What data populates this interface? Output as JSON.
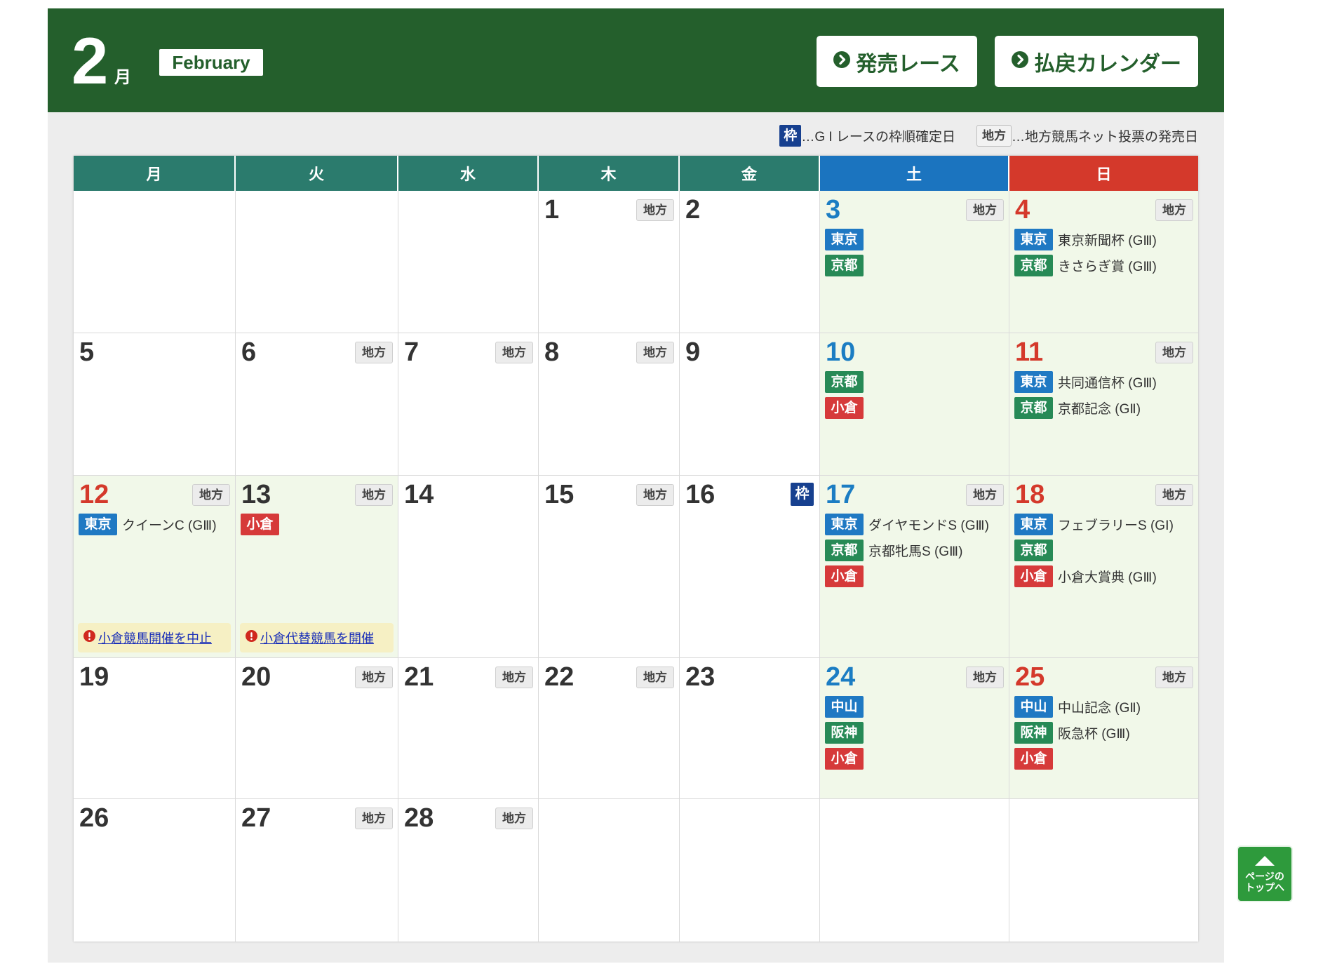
{
  "header": {
    "month_number": "2",
    "month_kanji": "月",
    "month_english": "February",
    "buttons": [
      {
        "label": "発売レース",
        "icon": "circle-chevron-right-icon"
      },
      {
        "label": "払戻カレンダー",
        "icon": "circle-chevron-right-icon"
      }
    ]
  },
  "labels": {
    "waku": "枠",
    "chiho": "地方"
  },
  "legend": [
    {
      "badge": "waku",
      "text": "…G I レースの枠順確定日"
    },
    {
      "badge": "chiho",
      "text": "…地方競馬ネット投票の発売日"
    }
  ],
  "weekdays": [
    {
      "label": "月",
      "tone": "weekday"
    },
    {
      "label": "火",
      "tone": "weekday"
    },
    {
      "label": "水",
      "tone": "weekday"
    },
    {
      "label": "木",
      "tone": "weekday"
    },
    {
      "label": "金",
      "tone": "weekday"
    },
    {
      "label": "土",
      "tone": "sat"
    },
    {
      "label": "日",
      "tone": "sun"
    }
  ],
  "colors": {
    "header_green": "#245f2c",
    "header_tones": {
      "weekday": "#2b7b6d",
      "sat": "#1b74bf",
      "sun": "#d4392b"
    },
    "day_tones": {
      "dark": "#333333",
      "blue": "#1b7dc3",
      "red": "#d4392b"
    },
    "shaded_cell": "#f1f8e9",
    "venues": {
      "東京": "#1f79c3",
      "京都": "#278a56",
      "小倉": "#d63a3a",
      "中山": "#1f79c3",
      "阪神": "#278a56"
    },
    "alert": "#d0281d",
    "page_top": "#2e9a3c"
  },
  "weeks": [
    [
      null,
      null,
      null,
      {
        "day": "1",
        "tone": "dark",
        "chiho": true
      },
      {
        "day": "2",
        "tone": "dark"
      },
      {
        "day": "3",
        "tone": "blue",
        "shaded": true,
        "chiho": true,
        "races": [
          {
            "venue": "東京"
          },
          {
            "venue": "京都"
          }
        ]
      },
      {
        "day": "4",
        "tone": "red",
        "shaded": true,
        "chiho": true,
        "races": [
          {
            "venue": "東京",
            "name": "東京新聞杯 (GⅢ)"
          },
          {
            "venue": "京都",
            "name": "きさらぎ賞 (GⅢ)"
          }
        ]
      }
    ],
    [
      {
        "day": "5",
        "tone": "dark"
      },
      {
        "day": "6",
        "tone": "dark",
        "chiho": true
      },
      {
        "day": "7",
        "tone": "dark",
        "chiho": true
      },
      {
        "day": "8",
        "tone": "dark",
        "chiho": true
      },
      {
        "day": "9",
        "tone": "dark"
      },
      {
        "day": "10",
        "tone": "blue",
        "shaded": true,
        "races": [
          {
            "venue": "京都"
          },
          {
            "venue": "小倉"
          }
        ]
      },
      {
        "day": "11",
        "tone": "red",
        "shaded": true,
        "chiho": true,
        "races": [
          {
            "venue": "東京",
            "name": "共同通信杯 (GⅢ)"
          },
          {
            "venue": "京都",
            "name": "京都記念 (GⅡ)"
          }
        ]
      }
    ],
    [
      {
        "day": "12",
        "tone": "red",
        "shaded": true,
        "chiho": true,
        "races": [
          {
            "venue": "東京",
            "name": "クイーンC (GⅢ)"
          }
        ],
        "notice": "小倉競馬開催を中止"
      },
      {
        "day": "13",
        "tone": "dark",
        "shaded": true,
        "chiho": true,
        "races": [
          {
            "venue": "小倉"
          }
        ],
        "notice": "小倉代替競馬を開催"
      },
      {
        "day": "14",
        "tone": "dark"
      },
      {
        "day": "15",
        "tone": "dark",
        "chiho": true
      },
      {
        "day": "16",
        "tone": "dark",
        "waku": true
      },
      {
        "day": "17",
        "tone": "blue",
        "shaded": true,
        "chiho": true,
        "races": [
          {
            "venue": "東京",
            "name": "ダイヤモンドS (GⅢ)"
          },
          {
            "venue": "京都",
            "name": "京都牝馬S (GⅢ)"
          },
          {
            "venue": "小倉"
          }
        ]
      },
      {
        "day": "18",
        "tone": "red",
        "shaded": true,
        "chiho": true,
        "races": [
          {
            "venue": "東京",
            "name": "フェブラリーS (GⅠ)"
          },
          {
            "venue": "京都"
          },
          {
            "venue": "小倉",
            "name": "小倉大賞典 (GⅢ)"
          }
        ]
      }
    ],
    [
      {
        "day": "19",
        "tone": "dark"
      },
      {
        "day": "20",
        "tone": "dark",
        "chiho": true
      },
      {
        "day": "21",
        "tone": "dark",
        "chiho": true
      },
      {
        "day": "22",
        "tone": "dark",
        "chiho": true
      },
      {
        "day": "23",
        "tone": "dark"
      },
      {
        "day": "24",
        "tone": "blue",
        "shaded": true,
        "chiho": true,
        "races": [
          {
            "venue": "中山"
          },
          {
            "venue": "阪神"
          },
          {
            "venue": "小倉"
          }
        ]
      },
      {
        "day": "25",
        "tone": "red",
        "shaded": true,
        "chiho": true,
        "races": [
          {
            "venue": "中山",
            "name": "中山記念 (GⅡ)"
          },
          {
            "venue": "阪神",
            "name": "阪急杯 (GⅢ)"
          },
          {
            "venue": "小倉"
          }
        ]
      }
    ],
    [
      {
        "day": "26",
        "tone": "dark"
      },
      {
        "day": "27",
        "tone": "dark",
        "chiho": true
      },
      {
        "day": "28",
        "tone": "dark",
        "chiho": true
      },
      null,
      null,
      null,
      null
    ]
  ],
  "page_top": {
    "line1": "ページの",
    "line2": "トップへ",
    "icon": "up-arrow-icon"
  }
}
